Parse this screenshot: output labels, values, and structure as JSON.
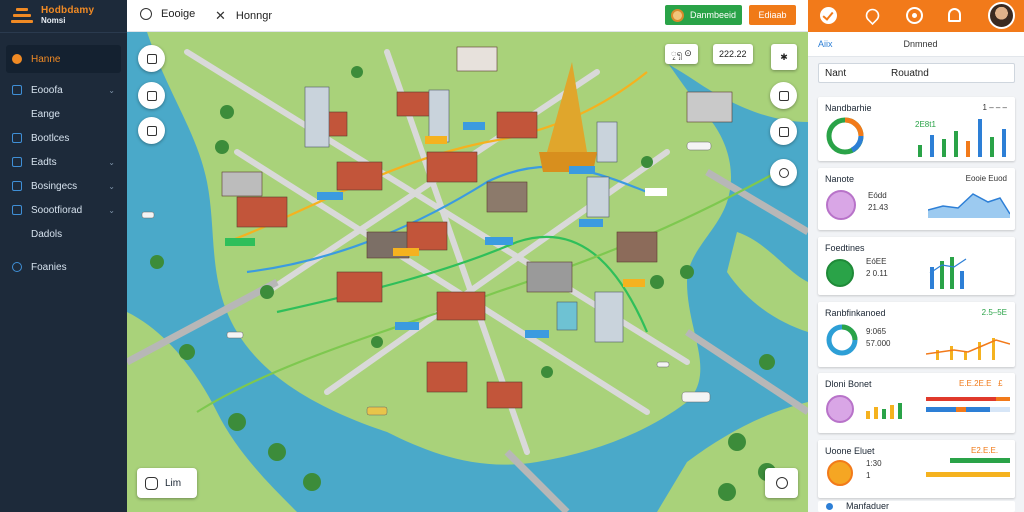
{
  "brand": {
    "name": "Hodbdamy",
    "sub": "Nomsi"
  },
  "sidebar": {
    "items": [
      {
        "label": "Hanne",
        "icon": "home-icon",
        "active": true,
        "chevron": false
      },
      {
        "label": "Eooofa",
        "icon": "map-icon",
        "active": false,
        "chevron": true
      },
      {
        "label": "Eange",
        "icon": "layers-icon",
        "active": false,
        "chevron": false
      },
      {
        "label": "Bootlces",
        "icon": "box-icon",
        "active": false,
        "chevron": false
      },
      {
        "label": "Eadts",
        "icon": "grid-icon",
        "active": false,
        "chevron": true
      },
      {
        "label": "Bosingecs",
        "icon": "chart-icon",
        "active": false,
        "chevron": true
      },
      {
        "label": "Soootfiorad",
        "icon": "folder-icon",
        "active": false,
        "chevron": true
      },
      {
        "label": "Dadols",
        "icon": "doc-icon",
        "active": false,
        "chevron": false
      },
      {
        "label": "Foanies",
        "icon": "settings-icon",
        "active": false,
        "chevron": false
      }
    ],
    "chevron_glyph": "⌄"
  },
  "topbar": {
    "item1": "Eooige",
    "item2": "Honngr",
    "close_glyph": "✕",
    "green_button": "Danmbeeid",
    "orange_button": "Ediaab"
  },
  "map": {
    "pill1": "ၠၡ ⊙",
    "pill2": "222.22",
    "legend_label": "Lim"
  },
  "panel": {
    "tabs": [
      "Aiix",
      "Dnmned"
    ],
    "search": {
      "key": "Nant",
      "value": "Rouatnd"
    },
    "cards": [
      {
        "title": "Nandbarhie",
        "meta": "1 – – –",
        "vals": "2E8t1"
      },
      {
        "title": "Nanote",
        "meta": "Eooie Euod",
        "vals": "Eódd\n21.43"
      },
      {
        "title": "Foedtines",
        "meta": "",
        "vals": "EóEE\n2 0.11"
      },
      {
        "title": "Ranbfinkanoed",
        "meta": "2.5–5E",
        "vals": "9:065\n57.000"
      },
      {
        "title": "Dloni Bonet",
        "meta": "E.E.2E.E   £  ",
        "vals": ""
      },
      {
        "title": "Uoone Eluet",
        "meta": "E2.E.E.    ",
        "vals": "1:30\n1   "
      }
    ],
    "footer_item": "Manfaduer"
  },
  "colors": {
    "sidebar_bg": "#1d2a3a",
    "accent_orange": "#f27a1a",
    "accent_green": "#2aa348",
    "accent_blue": "#2d7fd6",
    "water": "#4aa9c9"
  }
}
